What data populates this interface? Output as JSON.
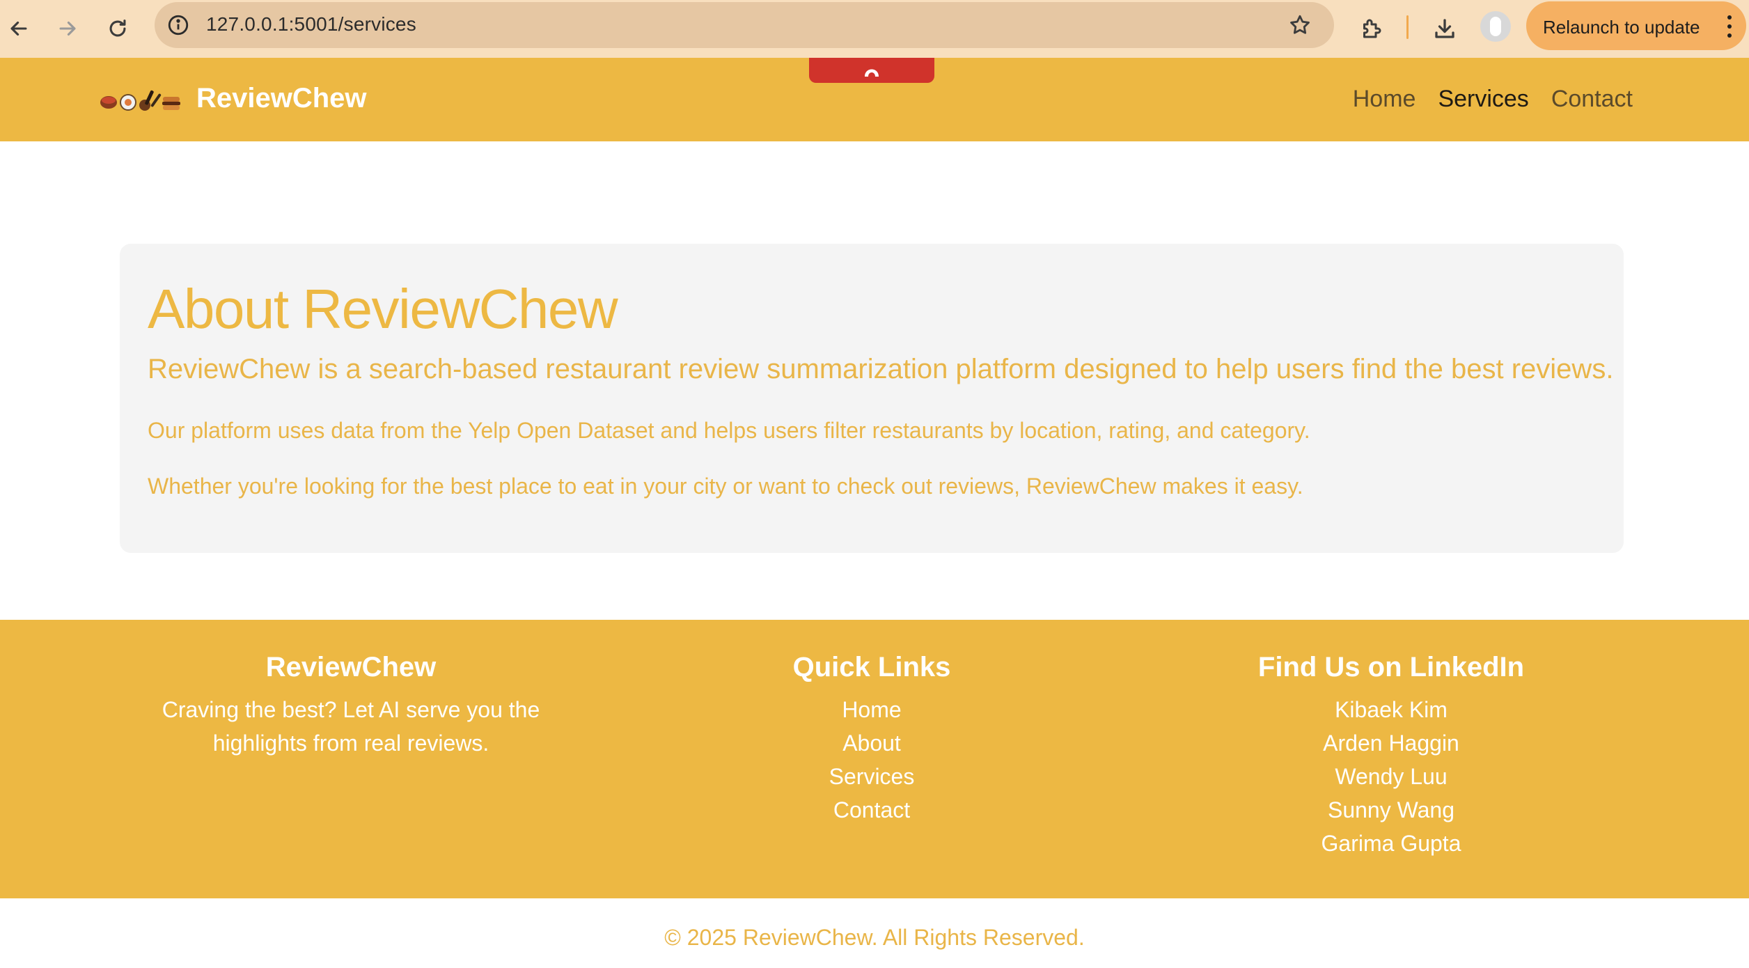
{
  "browser": {
    "url": "127.0.0.1:5001/services",
    "relaunch_label": "Relaunch to update",
    "icons": [
      "back-arrow-icon",
      "forward-arrow-icon",
      "reload-icon",
      "info-icon",
      "star-icon",
      "extensions-icon",
      "download-icon",
      "profile-icon",
      "more-vert-icon"
    ]
  },
  "navbar": {
    "brand": "ReviewChew",
    "links": [
      {
        "label": "Home",
        "active": false
      },
      {
        "label": "Services",
        "active": true
      },
      {
        "label": "Contact",
        "active": false
      }
    ]
  },
  "about": {
    "title": "About ReviewChew",
    "lead": "ReviewChew is a search-based restaurant review summarization platform designed to help users find the best reviews.",
    "p1": "Our platform uses data from the Yelp Open Dataset and helps users filter restaurants by location, rating, and category.",
    "p2": "Whether you're looking for the best place to eat in your city or want to check out reviews, ReviewChew makes it easy."
  },
  "footer": {
    "brand_heading": "ReviewChew",
    "tagline": "Craving the best? Let AI serve you the highlights from real reviews.",
    "quick_links_heading": "Quick Links",
    "quick_links": [
      "Home",
      "About",
      "Services",
      "Contact"
    ],
    "linkedin_heading": "Find Us on LinkedIn",
    "linkedin_people": [
      "Kibaek Kim",
      "Arden Haggin",
      "Wendy Luu",
      "Sunny Wang",
      "Garima Gupta"
    ]
  },
  "copyright": "© 2025 ReviewChew. All Rights Reserved.",
  "colors": {
    "brand_yellow": "#edb843",
    "chrome_bg": "#f8dfbe",
    "relaunch_bg": "#f5b062",
    "tab_red": "#d0332b"
  }
}
